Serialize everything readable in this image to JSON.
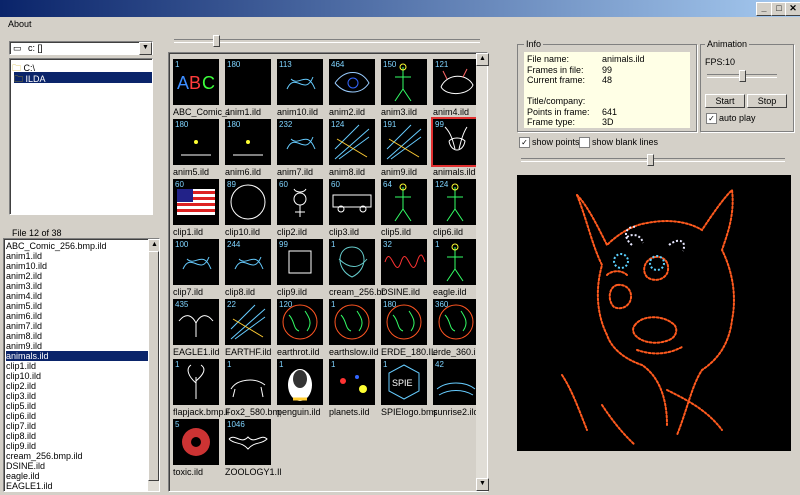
{
  "window": {
    "title": ""
  },
  "menu": {
    "about": "About"
  },
  "drive": {
    "selected": "c: []"
  },
  "tree": {
    "items": [
      "C:\\",
      "ILDA"
    ]
  },
  "file_count": "File 12 of 38",
  "files": [
    "ABC_Comic_256.bmp.ild",
    "anim1.ild",
    "anim10.ild",
    "anim2.ild",
    "anim3.ild",
    "anim4.ild",
    "anim5.ild",
    "anim6.ild",
    "anim7.ild",
    "anim8.ild",
    "anim9.ild",
    "animals.ild",
    "clip1.ild",
    "clip10.ild",
    "clip2.ild",
    "clip3.ild",
    "clip5.ild",
    "clip6.ild",
    "clip7.ild",
    "clip8.ild",
    "clip9.ild",
    "cream_256.bmp.ild",
    "DSINE.ild",
    "eagle.ild",
    "EAGLE1.ild"
  ],
  "selected_file_index": 11,
  "thumbnails": [
    {
      "label": "ABC_Comic_256",
      "num": "1",
      "art": "abc"
    },
    {
      "label": "anim1.ild",
      "num": "180",
      "art": "blank"
    },
    {
      "label": "anim10.ild",
      "num": "113",
      "art": "scribble"
    },
    {
      "label": "anim2.ild",
      "num": "464",
      "art": "eye"
    },
    {
      "label": "anim3.ild",
      "num": "150",
      "art": "figure"
    },
    {
      "label": "anim4.ild",
      "num": "121",
      "art": "animal"
    },
    {
      "label": "anim5.ild",
      "num": "180",
      "art": "dot"
    },
    {
      "label": "anim6.ild",
      "num": "180",
      "art": "dot"
    },
    {
      "label": "anim7.ild",
      "num": "232",
      "art": "scribble"
    },
    {
      "label": "anim8.ild",
      "num": "124",
      "art": "lines"
    },
    {
      "label": "anim9.ild",
      "num": "191",
      "art": "lines"
    },
    {
      "label": "animals.ild",
      "num": "99",
      "art": "horse"
    },
    {
      "label": "clip1.ild",
      "num": "60",
      "art": "flag"
    },
    {
      "label": "clip10.ild",
      "num": "89",
      "art": "circle"
    },
    {
      "label": "clip2.ild",
      "num": "60",
      "art": "mercury"
    },
    {
      "label": "clip3.ild",
      "num": "60",
      "art": "bus"
    },
    {
      "label": "clip5.ild",
      "num": "64",
      "art": "figure"
    },
    {
      "label": "clip6.ild",
      "num": "124",
      "art": "figure"
    },
    {
      "label": "clip7.ild",
      "num": "100",
      "art": "scribble"
    },
    {
      "label": "clip8.ild",
      "num": "244",
      "art": "scribble"
    },
    {
      "label": "clip9.ild",
      "num": "99",
      "art": "square"
    },
    {
      "label": "cream_256.bmp",
      "num": "1",
      "art": "knot"
    },
    {
      "label": "DSINE.ild",
      "num": "32",
      "art": "sine"
    },
    {
      "label": "eagle.ild",
      "num": "1",
      "art": "figure"
    },
    {
      "label": "EAGLE1.ild",
      "num": "435",
      "art": "eagle"
    },
    {
      "label": "EARTHF.ild",
      "num": "22",
      "art": "lines"
    },
    {
      "label": "earthrot.ild",
      "num": "120",
      "art": "globe"
    },
    {
      "label": "earthslow.ild",
      "num": "1",
      "art": "globe"
    },
    {
      "label": "ERDE_180.ILD",
      "num": "180",
      "art": "globe"
    },
    {
      "label": "erde_360.ild",
      "num": "360",
      "art": "globe"
    },
    {
      "label": "flapjack.bmp.ild",
      "num": "1",
      "art": "tree"
    },
    {
      "label": "Fox2_580.bmp",
      "num": "1",
      "art": "fox"
    },
    {
      "label": "penguin.ild",
      "num": "1",
      "art": "penguin"
    },
    {
      "label": "planets.ild",
      "num": "1",
      "art": "planets"
    },
    {
      "label": "SPIElogo.bmp.ild",
      "num": "1",
      "art": "spie"
    },
    {
      "label": "sunrise2.ild",
      "num": "42",
      "art": "sunrise"
    },
    {
      "label": "toxic.ild",
      "num": "5",
      "art": "toxic"
    },
    {
      "label": "ZOOLOGY1.ILD",
      "num": "1046",
      "art": "bat"
    }
  ],
  "selected_thumb_index": 11,
  "info": {
    "group_title": "Info",
    "rows": [
      {
        "label": "File name:",
        "value": "animals.ild"
      },
      {
        "label": "Frames in file:",
        "value": "99"
      },
      {
        "label": "Current frame:",
        "value": "48"
      },
      {
        "label": "",
        "value": ""
      },
      {
        "label": "Title/company:",
        "value": ""
      },
      {
        "label": "Points in frame:",
        "value": "641"
      },
      {
        "label": "Frame type:",
        "value": "3D"
      }
    ]
  },
  "animation": {
    "group_title": "Animation",
    "fps_label": "FPS:10",
    "fps_fraction": 0.5,
    "start": "Start",
    "stop": "Stop",
    "auto_play": "auto play",
    "auto_play_checked": true
  },
  "options": {
    "show_points": "show points",
    "show_points_checked": true,
    "show_blank_lines": "show blank lines",
    "show_blank_lines_checked": false
  },
  "frame_slider_fraction": 0.49,
  "top_slider_fraction": 0.13,
  "colors": {
    "selection": "#0a246a",
    "accent": "#e03030",
    "laser_orange": "#ff5a1e"
  }
}
